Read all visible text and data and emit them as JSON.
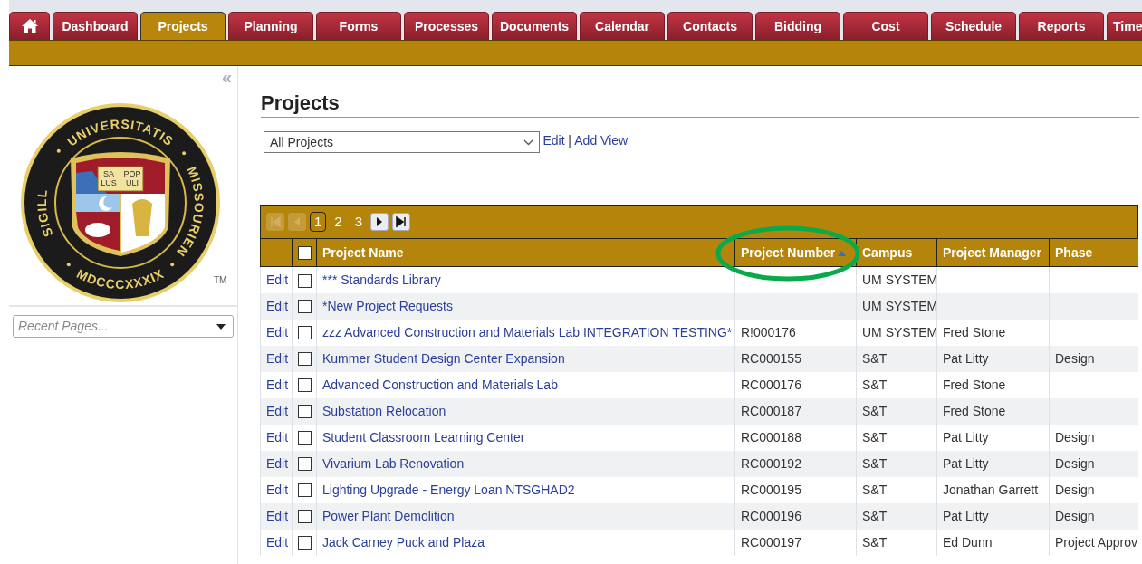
{
  "tabs": [
    {
      "kind": "home",
      "selected": false
    },
    {
      "label": "Dashboard",
      "selected": false
    },
    {
      "label": "Projects",
      "selected": true
    },
    {
      "label": "Planning",
      "selected": false
    },
    {
      "label": "Forms",
      "selected": false
    },
    {
      "label": "Processes",
      "selected": false
    },
    {
      "label": "Documents",
      "selected": false
    },
    {
      "label": "Calendar",
      "selected": false
    },
    {
      "label": "Contacts",
      "selected": false
    },
    {
      "label": "Bidding",
      "selected": false
    },
    {
      "label": "Cost",
      "selected": false
    },
    {
      "label": "Schedule",
      "selected": false
    },
    {
      "label": "Reports",
      "selected": false
    },
    {
      "label": "Time",
      "selected": false
    }
  ],
  "sidebar": {
    "collapse": "«",
    "seal": {
      "ring_text": [
        "SIGILL",
        "UNIVERSITATIS",
        "MISSOURIEN"
      ],
      "year": "MDCCCXXXIX",
      "book_left": [
        "SA",
        "LUS"
      ],
      "book_right": [
        "POP",
        "ULI"
      ],
      "trademark": "TM"
    },
    "recent_pages": {
      "placeholder": "Recent Pages..."
    }
  },
  "page": {
    "title": "Projects",
    "view_select": "All Projects",
    "links": [
      "Edit",
      "Add View"
    ],
    "separator": "|"
  },
  "table": {
    "pager": {
      "nav": [
        {
          "kind": "first",
          "disabled": true
        },
        {
          "kind": "prev",
          "disabled": true
        },
        {
          "kind": "next",
          "disabled": false
        },
        {
          "kind": "last",
          "disabled": false
        }
      ],
      "pages": [
        {
          "label": "1",
          "selected": true
        },
        {
          "label": "2",
          "selected": false
        },
        {
          "label": "3",
          "selected": false
        }
      ]
    },
    "select_all": {
      "checked": false
    },
    "columns": [
      {
        "label": "Project Name"
      },
      {
        "label": "Project Number",
        "sorted_ascending": true,
        "circled": true
      },
      {
        "label": "Campus"
      },
      {
        "label": "Project Manager"
      },
      {
        "label": "Phase"
      }
    ],
    "rows": [
      {
        "edit": "Edit",
        "checked": false,
        "name": "*** Standards Library",
        "campus": "UM SYSTEM"
      },
      {
        "edit": "Edit",
        "checked": false,
        "name": "*New Project Requests",
        "campus": "UM SYSTEM"
      },
      {
        "edit": "Edit",
        "checked": false,
        "name": "zzz Advanced Construction and Materials Lab INTEGRATION TESTING*",
        "number": "R!000176",
        "campus": "UM SYSTEM",
        "manager": "Fred Stone"
      },
      {
        "edit": "Edit",
        "checked": false,
        "name": "Kummer Student Design Center Expansion",
        "number": "RC000155",
        "campus": "S&T",
        "manager": "Pat Litty",
        "phase": "Design"
      },
      {
        "edit": "Edit",
        "checked": false,
        "name": "Advanced Construction and Materials Lab",
        "number": "RC000176",
        "campus": "S&T",
        "manager": "Fred Stone"
      },
      {
        "edit": "Edit",
        "checked": false,
        "name": "Substation Relocation",
        "number": "RC000187",
        "campus": "S&T",
        "manager": "Fred Stone"
      },
      {
        "edit": "Edit",
        "checked": false,
        "name": "Student Classroom Learning Center",
        "number": "RC000188",
        "campus": "S&T",
        "manager": "Pat Litty",
        "phase": "Design"
      },
      {
        "edit": "Edit",
        "checked": false,
        "name": "Vivarium Lab Renovation",
        "number": "RC000192",
        "campus": "S&T",
        "manager": "Pat Litty",
        "phase": "Design"
      },
      {
        "edit": "Edit",
        "checked": false,
        "name": "Lighting Upgrade - Energy Loan NTSGHAD2",
        "number": "RC000195",
        "campus": "S&T",
        "manager": "Jonathan Garrett",
        "phase": "Design"
      },
      {
        "edit": "Edit",
        "checked": false,
        "name": "Power Plant Demolition",
        "number": "RC000196",
        "campus": "S&T",
        "manager": "Pat Litty",
        "phase": "Design"
      },
      {
        "edit": "Edit",
        "checked": false,
        "name": "Jack Carney Puck and Plaza",
        "number": "RC000197",
        "campus": "S&T",
        "manager": "Ed Dunn",
        "phase": "Project Approv"
      }
    ]
  }
}
